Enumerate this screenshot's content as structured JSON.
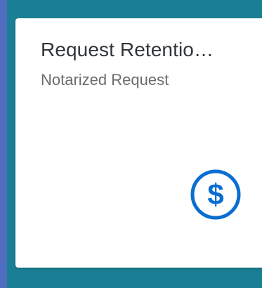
{
  "tile": {
    "title": "Request Retentio…",
    "subtitle": "Notarized Request",
    "icon": "dollar-circle-icon",
    "icon_color": "#0a6ed1"
  },
  "colors": {
    "outer_background": "#4f6ec0",
    "area_background": "#1a7f95",
    "tile_background": "#ffffff",
    "title_color": "#32363a",
    "subtitle_color": "#6a6d70"
  }
}
